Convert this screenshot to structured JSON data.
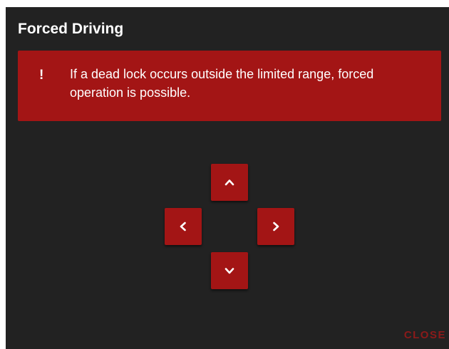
{
  "dialog": {
    "title": "Forced Driving",
    "alert": {
      "icon": "!",
      "icon_name": "exclamation-icon",
      "message": "If a dead lock occurs outside the limited range, forced operation is possible."
    },
    "controls": {
      "up_icon": "chevron-up-icon",
      "left_icon": "chevron-left-icon",
      "right_icon": "chevron-right-icon",
      "down_icon": "chevron-down-icon"
    },
    "close_label": "CLOSE"
  },
  "colors": {
    "background": "#222222",
    "accent": "#a31515",
    "close_text": "#8b1a1a",
    "text": "#ffffff"
  }
}
